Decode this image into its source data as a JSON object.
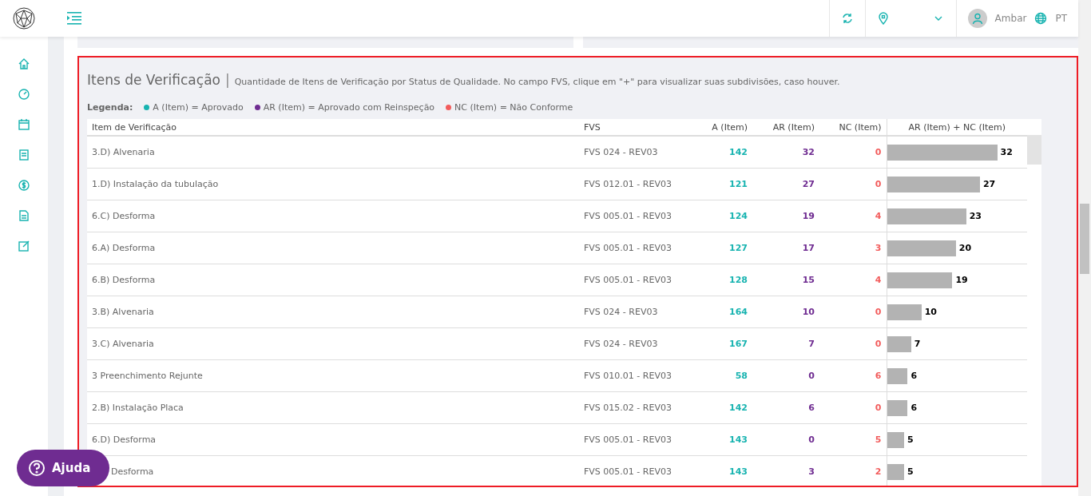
{
  "header": {
    "user": "Ambar",
    "language": "PT"
  },
  "panel": {
    "title": "Itens de Verificação",
    "separator": "|",
    "subtitle": "Quantidade de Itens de Verificação por Status de Qualidade. No campo FVS, clique em \"+\" para visualizar suas subdivisões, caso houver.",
    "legend_label": "Legenda:",
    "legend": [
      {
        "text": "A (Item) = Aprovado",
        "color": "#17b3b0"
      },
      {
        "text": "AR (Item) = Aprovado com Reinspeção",
        "color": "#6f2c91"
      },
      {
        "text": "NC (Item) = Não Conforme",
        "color": "#f25c5c"
      }
    ],
    "columns": [
      "Item de Verificação",
      "FVS",
      "A (Item)",
      "AR (Item)",
      "NC (Item)",
      "AR (Item) + NC (Item)"
    ],
    "rows": [
      {
        "item": "3.D) Alvenaria",
        "fvs": "FVS 024 - REV03",
        "a": "142",
        "ar": "32",
        "nc": "0",
        "total": "32",
        "covered": false
      },
      {
        "item": "1.D) Instalação da tubulação",
        "fvs": "FVS 012.01 - REV03",
        "a": "121",
        "ar": "27",
        "nc": "0",
        "total": "27",
        "covered": false
      },
      {
        "item": "6.C) Desforma",
        "fvs": "FVS 005.01 - REV03",
        "a": "124",
        "ar": "19",
        "nc": "4",
        "total": "23",
        "covered": false
      },
      {
        "item": "6.A) Desforma",
        "fvs": "FVS 005.01 - REV03",
        "a": "127",
        "ar": "17",
        "nc": "3",
        "total": "20",
        "covered": false
      },
      {
        "item": "6.B) Desforma",
        "fvs": "FVS 005.01 - REV03",
        "a": "128",
        "ar": "15",
        "nc": "4",
        "total": "19",
        "covered": false
      },
      {
        "item": "3.B) Alvenaria",
        "fvs": "FVS 024 - REV03",
        "a": "164",
        "ar": "10",
        "nc": "0",
        "total": "10",
        "covered": false
      },
      {
        "item": "3.C) Alvenaria",
        "fvs": "FVS 024 - REV03",
        "a": "167",
        "ar": "7",
        "nc": "0",
        "total": "7",
        "covered": false
      },
      {
        "item": "3 Preenchimento Rejunte",
        "fvs": "FVS 010.01 - REV03",
        "a": "58",
        "ar": "0",
        "nc": "6",
        "total": "6",
        "covered": false
      },
      {
        "item": "2.B) Instalação Placa",
        "fvs": "FVS 015.02 - REV03",
        "a": "142",
        "ar": "6",
        "nc": "0",
        "total": "6",
        "covered": false
      },
      {
        "item": "6.D) Desforma",
        "fvs": "FVS 005.01 - REV03",
        "a": "143",
        "ar": "0",
        "nc": "5",
        "total": "5",
        "covered": false
      },
      {
        "item": "Desforma",
        "fvs": "FVS 005.01 - REV03",
        "a": "143",
        "ar": "3",
        "nc": "2",
        "total": "5",
        "covered": true
      }
    ]
  },
  "help_button": {
    "label": "Ajuda"
  }
}
